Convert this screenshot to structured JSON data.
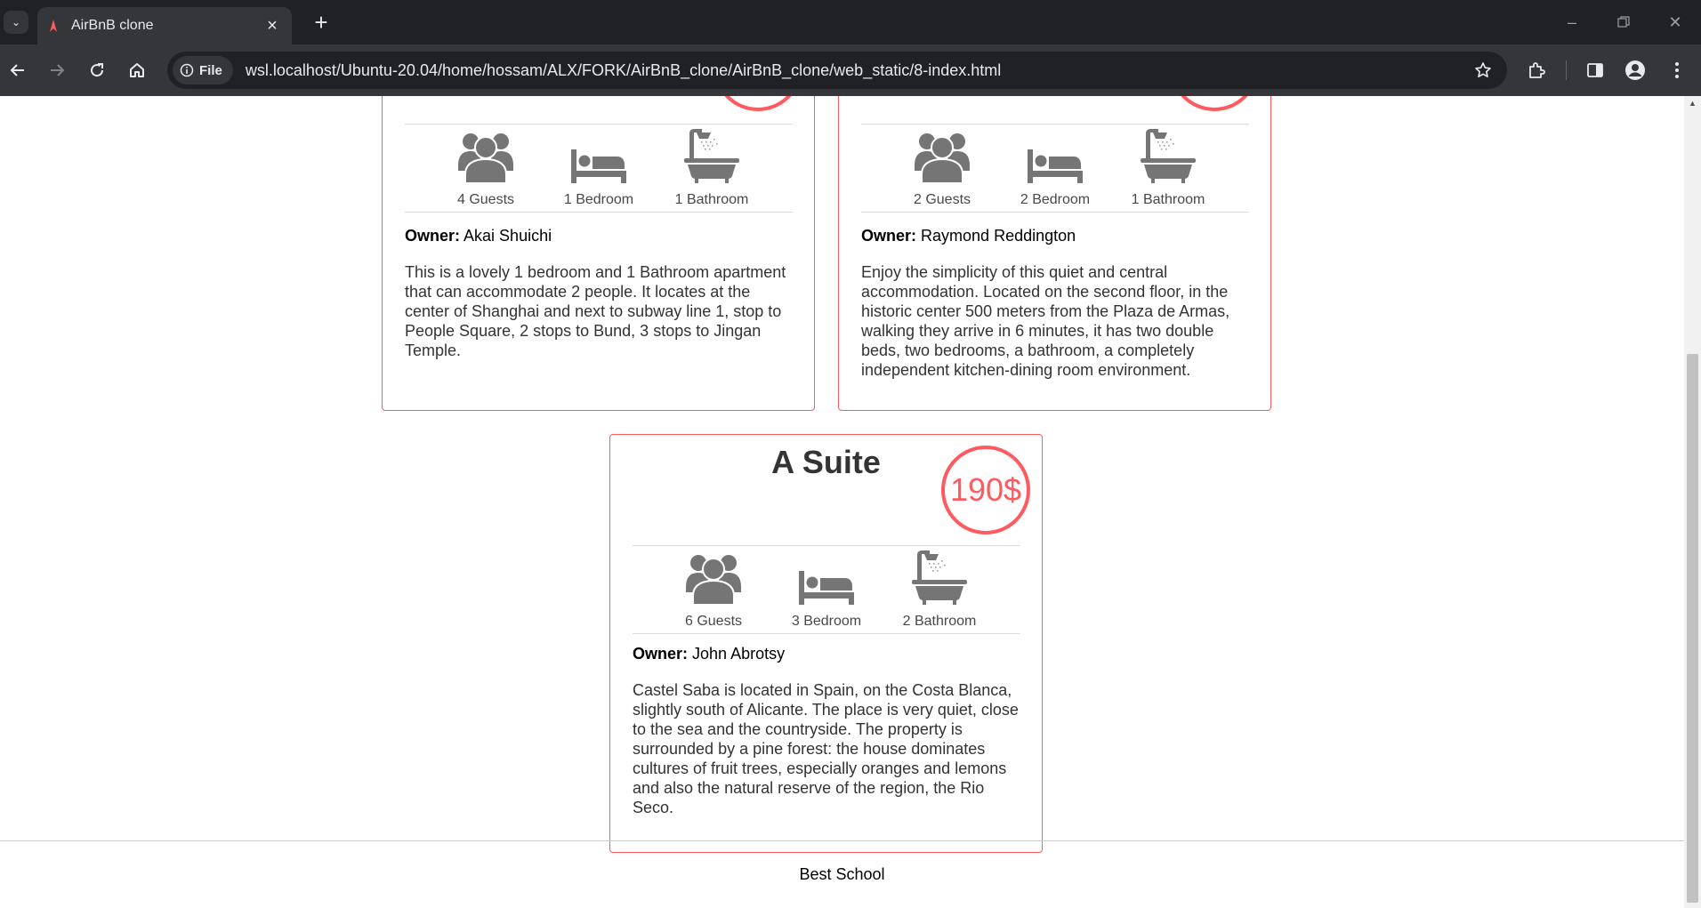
{
  "browser": {
    "tab_title": "AirBnB clone",
    "site_chip": "File",
    "url": "wsl.localhost/Ubuntu-20.04/home/hossam/ALX/FORK/AirBnB_clone/AirBnB_clone/web_static/8-index.html"
  },
  "places": [
    {
      "title": "",
      "price": "",
      "guests": "4 Guests",
      "bedrooms": "1 Bedroom",
      "bathrooms": "1 Bathroom",
      "owner_label": "Owner:",
      "owner_name": "Akai Shuichi",
      "description": "This is a lovely 1 bedroom and 1 Bathroom apartment that can accommodate 2 people. It locates at the center of Shanghai and next to subway line 1, stop to People Square, 2 stops to Bund, 3 stops to Jingan Temple."
    },
    {
      "title": "",
      "price": "",
      "guests": "2 Guests",
      "bedrooms": "2 Bedroom",
      "bathrooms": "1 Bathroom",
      "owner_label": "Owner:",
      "owner_name": "Raymond Reddington",
      "description": "Enjoy the simplicity of this quiet and central accommodation. Located on the second floor, in the historic center 500 meters from the Plaza de Armas, walking they arrive in 6 minutes, it has two double beds, two bedrooms, a bathroom, a completely independent kitchen-dining room environment."
    },
    {
      "title": "A Suite",
      "price": "190$",
      "guests": "6 Guests",
      "bedrooms": "3 Bedroom",
      "bathrooms": "2 Bathroom",
      "owner_label": "Owner:",
      "owner_name": "John Abrotsy",
      "description": "Castel Saba is located in Spain, on the Costa Blanca, slightly south of Alicante. The place is very quiet, close to the sea and the countryside. The property is surrounded by a pine forest: the house dominates cultures of fruit trees, especially oranges and lemons and also the natural reserve of the region, the Rio Seco."
    }
  ],
  "footer": {
    "text": "Best School"
  },
  "colors": {
    "accent": "#ff5a5f",
    "icon_gray": "#757575",
    "chrome_dark": "#202124",
    "chrome": "#35363a"
  },
  "icons": [
    "tab-search-icon",
    "favicon-icon",
    "close-icon",
    "plus-icon",
    "back-icon",
    "forward-icon",
    "reload-icon",
    "home-icon",
    "info-icon",
    "star-icon",
    "extensions-icon",
    "side-panel-icon",
    "profile-icon",
    "menu-icon",
    "guests-icon",
    "bed-icon",
    "bath-icon"
  ]
}
